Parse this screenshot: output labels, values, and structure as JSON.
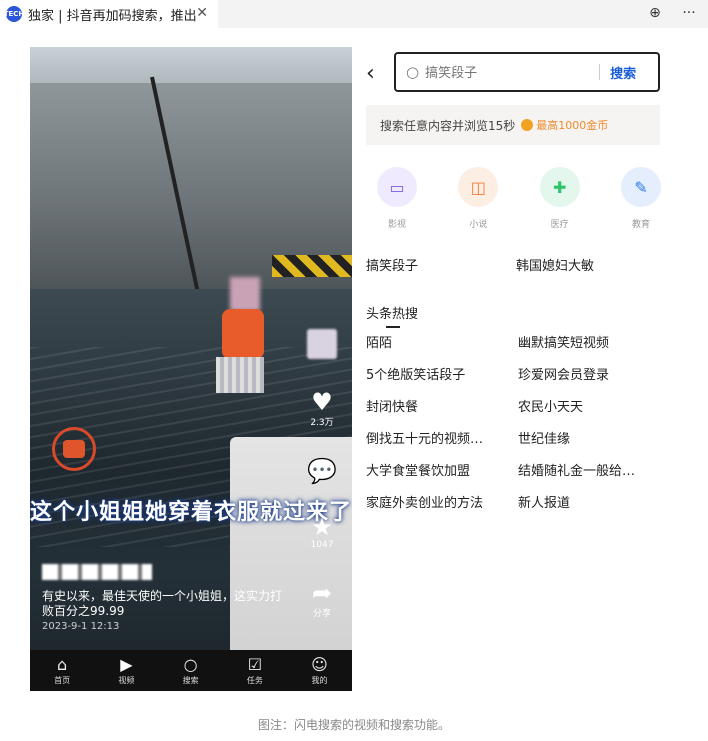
{
  "browser": {
    "tab_title": "独家 | 抖音再加码搜索，推出",
    "close_glyph": "✕",
    "globe_glyph": "⊕",
    "more_glyph": "···",
    "favicon_text": "TECH"
  },
  "video": {
    "big_caption": "这个小姐姐她穿着衣服就过来了",
    "description": "有史以来，最佳天使的一个小姐姐，这实力打败百分之99.99",
    "date": "2023-9-1 12:13",
    "actions": {
      "like_count": "2.3万",
      "star_count": "1047",
      "share_label": "分享"
    },
    "nav": [
      {
        "label": "首页",
        "icon": "home-icon"
      },
      {
        "label": "视频",
        "icon": "play-icon"
      },
      {
        "label": "搜索",
        "icon": "search-icon"
      },
      {
        "label": "任务",
        "icon": "task-icon"
      },
      {
        "label": "我的",
        "icon": "profile-icon"
      }
    ]
  },
  "search": {
    "placeholder": "搞笑段子",
    "button_label": "搜索",
    "promo_text": "搜索任意内容并浏览15秒",
    "promo_reward": "最高1000金币",
    "categories": [
      {
        "label": "影视",
        "icon": "video-icon",
        "color": "#7b5ce6",
        "bg": "#efeafd"
      },
      {
        "label": "小说",
        "icon": "book-icon",
        "color": "#f07a35",
        "bg": "#fdeee4"
      },
      {
        "label": "医疗",
        "icon": "medical-cross-icon",
        "color": "#2ec46b",
        "bg": "#e3f7ec"
      },
      {
        "label": "教育",
        "icon": "education-icon",
        "color": "#2e7be6",
        "bg": "#e4eefc"
      }
    ],
    "recent": [
      "搞笑段子",
      "韩国媳妇大敏"
    ],
    "hot_title": "头条热搜",
    "hot_items": [
      "陌陌",
      "幽默搞笑短视频",
      "5个绝版笑话段子",
      "珍爱网会员登录",
      "封闭快餐",
      "农民小天天",
      "倒找五十元的视频…",
      "世纪佳缘",
      "大学食堂餐饮加盟",
      "结婚随礼金一般给…",
      "家庭外卖创业的方法",
      "新人报道"
    ]
  },
  "figure_caption": "图注：闪电搜索的视频和搜索功能。"
}
